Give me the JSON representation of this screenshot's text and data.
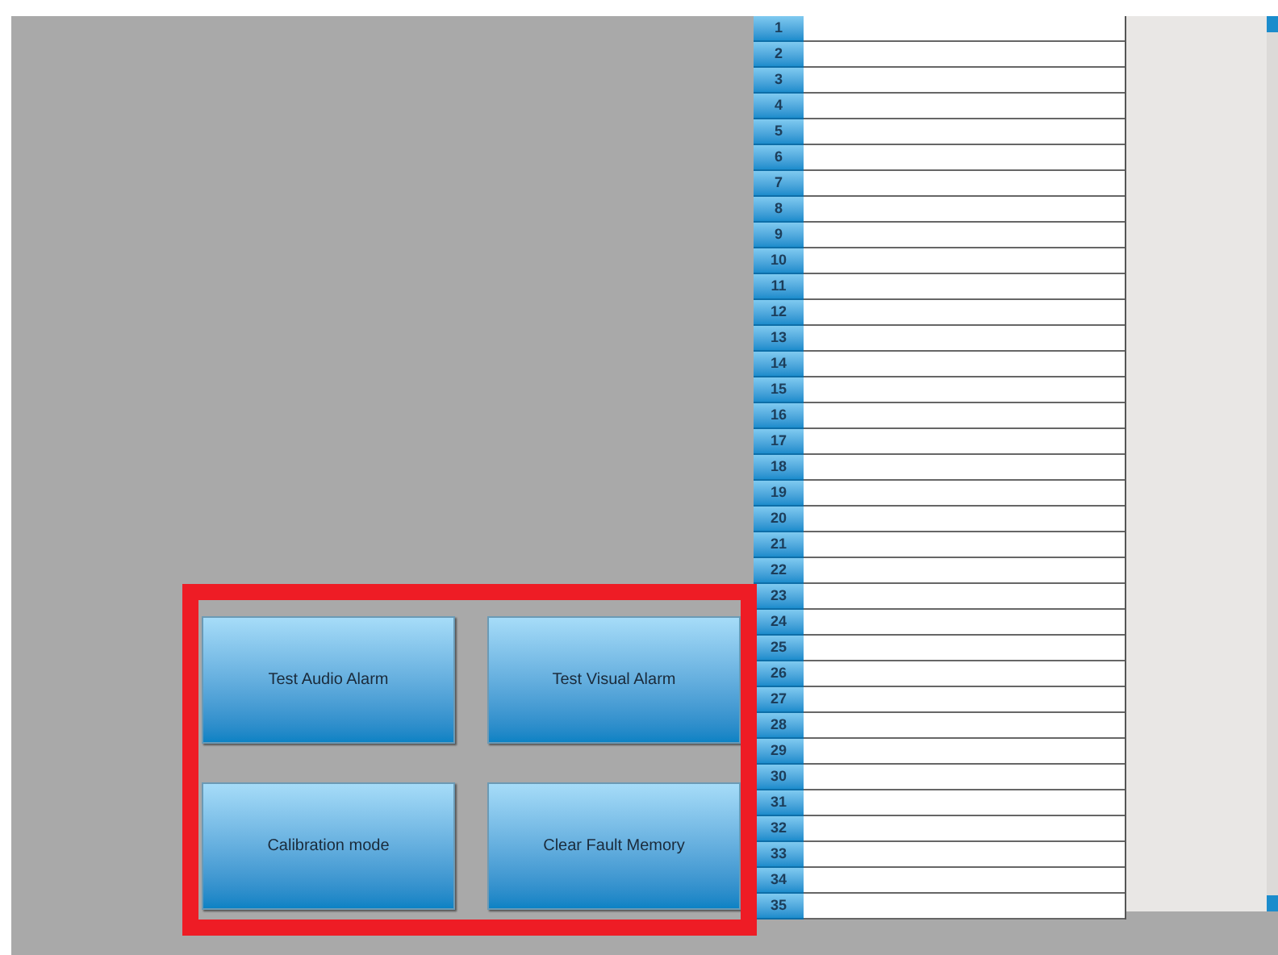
{
  "buttons": [
    {
      "label": "Test Audio Alarm"
    },
    {
      "label": "Test Visual Alarm"
    },
    {
      "label": "Calibration mode"
    },
    {
      "label": "Clear Fault Memory"
    }
  ],
  "table": {
    "row_headers": [
      "1",
      "2",
      "3",
      "4",
      "5",
      "6",
      "7",
      "8",
      "9",
      "10",
      "11",
      "12",
      "13",
      "14",
      "15",
      "16",
      "17",
      "18",
      "19",
      "20",
      "21",
      "22",
      "23",
      "24",
      "25",
      "26",
      "27",
      "28",
      "29",
      "30",
      "31",
      "32",
      "33",
      "34",
      "35"
    ]
  },
  "highlight": {
    "on": true
  }
}
